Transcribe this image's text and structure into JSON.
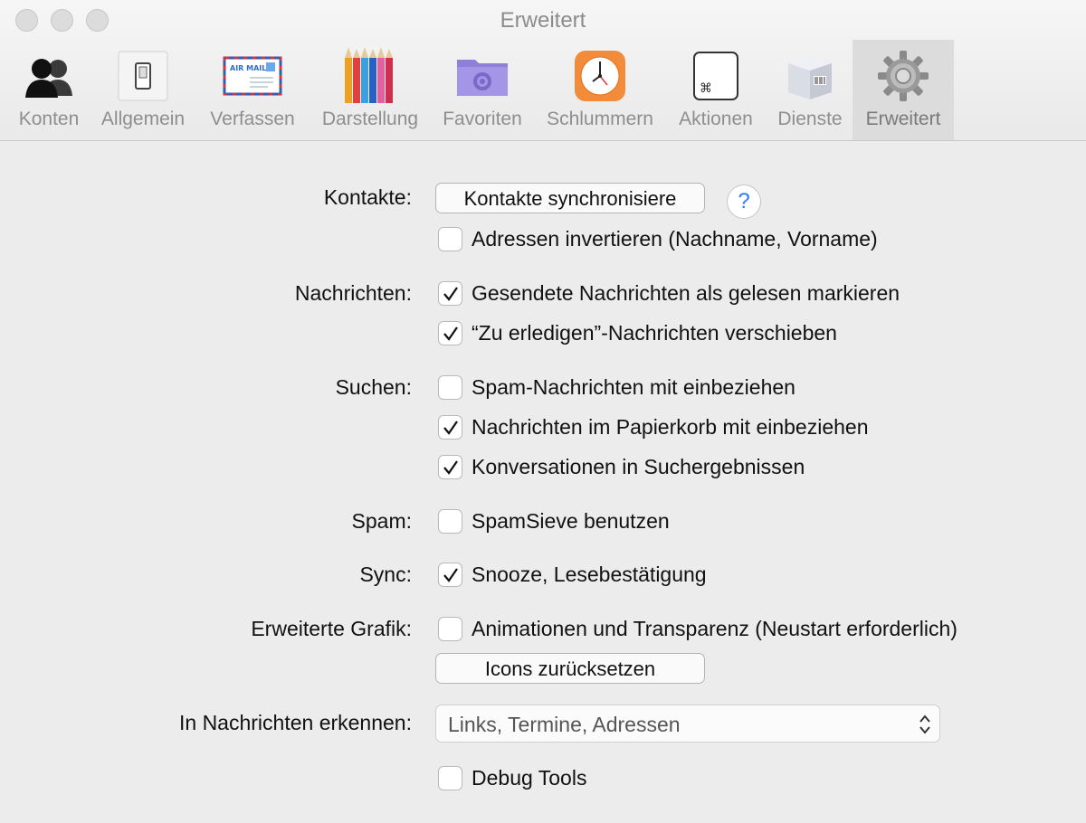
{
  "window": {
    "title": "Erweitert"
  },
  "tabs": [
    {
      "label": "Konten",
      "icon": "accounts-icon"
    },
    {
      "label": "Allgemein",
      "icon": "switch-icon"
    },
    {
      "label": "Verfassen",
      "icon": "airmail-envelope-icon"
    },
    {
      "label": "Darstellung",
      "icon": "colored-pencils-icon"
    },
    {
      "label": "Favoriten",
      "icon": "folder-gear-icon"
    },
    {
      "label": "Schlummern",
      "icon": "alarm-clock-icon"
    },
    {
      "label": "Aktionen",
      "icon": "command-key-icon"
    },
    {
      "label": "Dienste",
      "icon": "services-box-icon"
    },
    {
      "label": "Erweitert",
      "icon": "gear-icon",
      "active": true
    }
  ],
  "contacts": {
    "label": "Kontakte:",
    "sync_button": "Kontakte synchronisiere",
    "help": "?",
    "invert": {
      "text": "Adressen invertieren (Nachname, Vorname)",
      "checked": false
    }
  },
  "messages": {
    "label": "Nachrichten:",
    "mark_sent_read": {
      "text": "Gesendete Nachrichten als gelesen markieren",
      "checked": true
    },
    "move_todo": {
      "text": "“Zu erledigen”-Nachrichten verschieben",
      "checked": true
    }
  },
  "search": {
    "label": "Suchen:",
    "include_spam": {
      "text": "Spam-Nachrichten mit einbeziehen",
      "checked": false
    },
    "include_trash": {
      "text": "Nachrichten im Papierkorb mit einbeziehen",
      "checked": true
    },
    "conversations": {
      "text": "Konversationen in Suchergebnissen",
      "checked": true
    }
  },
  "spam": {
    "label": "Spam:",
    "spamsieve": {
      "text": "SpamSieve benutzen",
      "checked": false
    }
  },
  "sync": {
    "label": "Sync:",
    "snooze_receipts": {
      "text": "Snooze, Lesebestätigung",
      "checked": true
    }
  },
  "graphics": {
    "label": "Erweiterte Grafik:",
    "animations": {
      "text": "Animationen und Transparenz (Neustart erforderlich)",
      "checked": false
    },
    "reset_icons_button": "Icons zurücksetzen"
  },
  "detect": {
    "label": "In Nachrichten erkennen:",
    "selected": "Links, Termine, Adressen"
  },
  "debug": {
    "tools": {
      "text": "Debug Tools",
      "checked": false
    }
  },
  "colors": {
    "accent": "#2f7cf0",
    "background": "#ececec"
  }
}
